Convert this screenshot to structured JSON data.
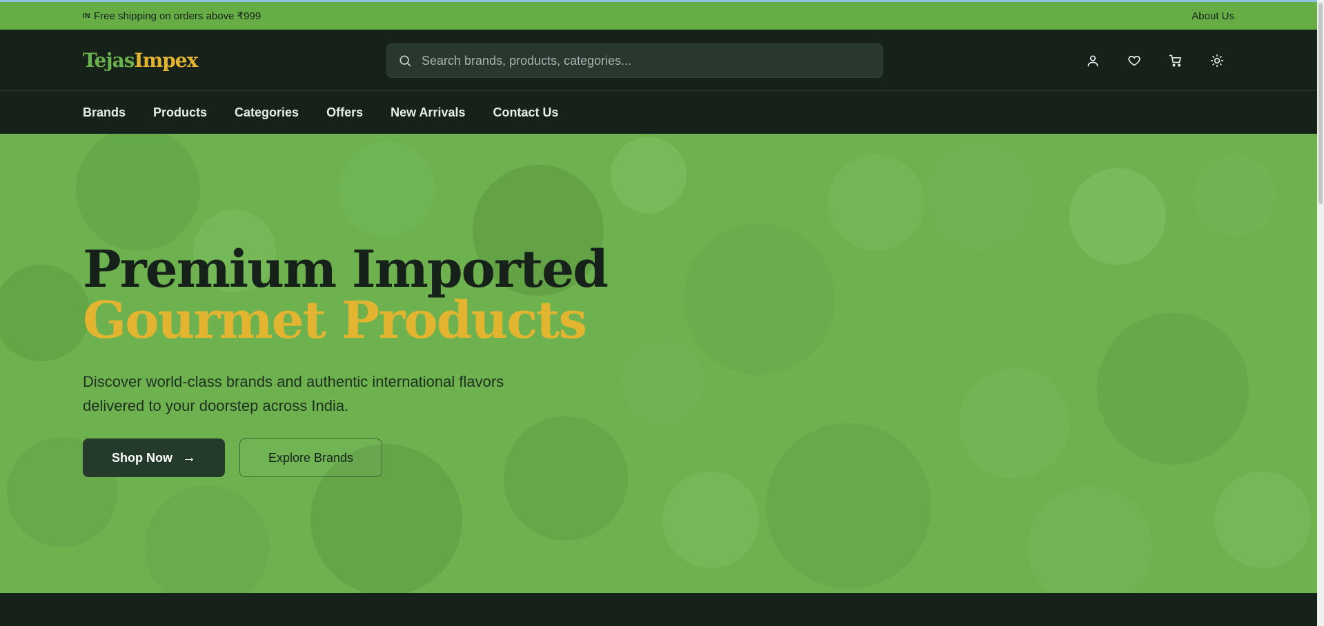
{
  "announcement": {
    "flag": "IN",
    "text": "Free shipping on orders above ₹999",
    "about_link": "About Us"
  },
  "header": {
    "logo_part1": "Tejas",
    "logo_part2": "Impex",
    "search_placeholder": "Search brands, products, categories...",
    "icons": [
      "user-icon",
      "heart-icon",
      "cart-icon",
      "sun-icon"
    ]
  },
  "nav": {
    "items": [
      "Brands",
      "Products",
      "Categories",
      "Offers",
      "New Arrivals",
      "Contact Us"
    ]
  },
  "hero": {
    "title_line1": "Premium Imported",
    "title_line2": "Gourmet Products",
    "subtitle": "Discover world-class brands and authentic international flavors delivered to your doorstep across India.",
    "primary_button": "Shop Now",
    "secondary_button": "Explore Brands"
  },
  "colors": {
    "brand_green": "#65ad44",
    "brand_gold": "#e3b430",
    "dark": "#16211a"
  }
}
